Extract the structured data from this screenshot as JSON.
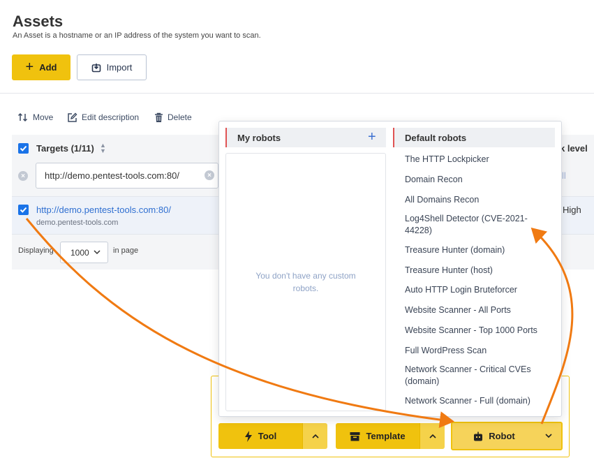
{
  "header": {
    "title": "Assets",
    "subtitle": "An Asset is a hostname or an IP address of the system you want to scan.",
    "add_label": "Add",
    "import_label": "Import"
  },
  "toolbar": {
    "move_label": "Move",
    "edit_label": "Edit description",
    "delete_label": "Delete"
  },
  "table": {
    "targets_header": "Targets (1/11)",
    "risk_header": "k level",
    "filter_value": "http://demo.pentest-tools.com:80/",
    "filter_right_partial": "ll",
    "row": {
      "url": "http://demo.pentest-tools.com:80/",
      "host": "demo.pentest-tools.com",
      "risk": "High"
    },
    "pager_prefix": "Displaying",
    "pager_value": "1000",
    "pager_suffix": "in page"
  },
  "popup": {
    "my_robots_title": "My robots",
    "empty_message": "You don't have any custom robots.",
    "default_robots_title": "Default robots",
    "default_robots": [
      "The HTTP Lockpicker",
      "Domain Recon",
      "All Domains Recon",
      "Log4Shell Detector (CVE-2021-44228)",
      "Treasure Hunter (domain)",
      "Treasure Hunter (host)",
      "Auto HTTP Login Bruteforcer",
      "Website Scanner - All Ports",
      "Website Scanner - Top 1000 Ports",
      "Full WordPress Scan",
      "Network Scanner - Critical CVEs (domain)",
      "Network Scanner - Full (domain)"
    ]
  },
  "run": {
    "tool_label": "Tool",
    "template_label": "Template",
    "robot_label": "Robot"
  },
  "colors": {
    "accent": "#f0c20e",
    "link": "#2f6fd1",
    "annotation_arrow": "#f07a12"
  }
}
